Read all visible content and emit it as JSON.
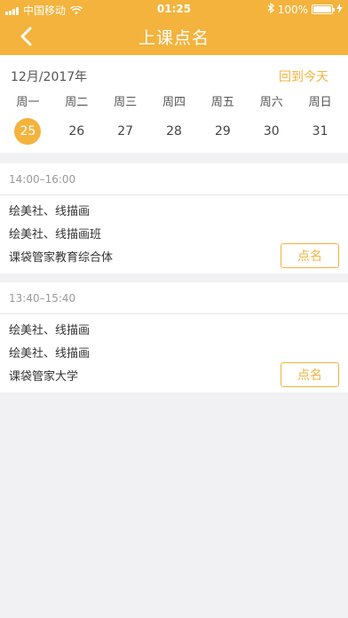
{
  "status_bar": {
    "carrier": "中国移动",
    "time": "01:25",
    "battery": "100%",
    "battery_level": 1.0
  },
  "nav": {
    "title": "上课点名"
  },
  "calendar": {
    "month_label": "12月/2017年",
    "today_label": "回到今天",
    "weekdays": [
      "周一",
      "周二",
      "周三",
      "周四",
      "周五",
      "周六",
      "周日"
    ],
    "days": [
      "25",
      "26",
      "27",
      "28",
      "29",
      "30",
      "31"
    ],
    "selected_index": 0
  },
  "sessions": [
    {
      "time": "14:00–16:00",
      "lines": [
        "绘美社、线描画",
        "绘美社、线描画班",
        "课袋管家教育综合体"
      ],
      "button_label": "点名"
    },
    {
      "time": "13:40–15:40",
      "lines": [
        "绘美社、线描画",
        "绘美社、线描画",
        "课袋管家大学"
      ],
      "button_label": "点名"
    }
  ],
  "colors": {
    "accent": "#f3b33d",
    "background": "#f1f1f3"
  }
}
